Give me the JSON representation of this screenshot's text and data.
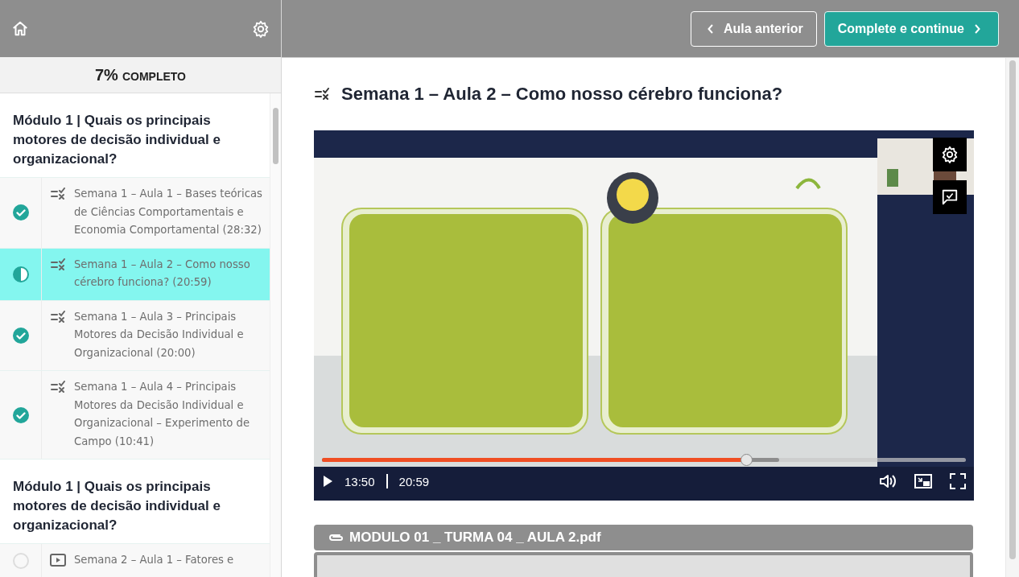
{
  "topbar": {
    "buttons": [
      {
        "label": "Aula anterior",
        "kind": "prev"
      },
      {
        "label": "Complete e continue",
        "kind": "next"
      }
    ]
  },
  "sidebar": {
    "progress": {
      "percent": "7%",
      "label": "COMPLETO"
    },
    "sections": [
      {
        "title": "Módulo 1 | Quais os principais motores de decisão individual e organizacional?",
        "lessons": [
          {
            "title": "Semana 1 – Aula 1 – Bases teóricas de Ciências Comportamentais e Economia Comportamental (28:32)",
            "kind": "quiz",
            "completed": true,
            "selected": false
          },
          {
            "title": "Semana 1 – Aula 2 – Como nosso cérebro funciona? (20:59)",
            "kind": "quiz",
            "completed": false,
            "selected": true
          },
          {
            "title": "Semana 1 – Aula 3 – Principais Motores da Decisão Individual e Organizacional (20:00)",
            "kind": "quiz",
            "completed": true,
            "selected": false
          },
          {
            "title": "Semana 1 – Aula 4 – Principais Motores da Decisão Individual e Organizacional – Experimento de Campo (10:41)",
            "kind": "quiz",
            "completed": true,
            "selected": false
          }
        ]
      },
      {
        "title": "Módulo 1 | Quais os principais motores de decisão individual e organizacional?",
        "lessons": [
          {
            "title": "Semana 2 – Aula 1 – Fatores e",
            "kind": "video",
            "completed": false,
            "selected": false
          }
        ]
      }
    ]
  },
  "lesson": {
    "title": "Semana 1 – Aula 2 – Como nosso cérebro funciona?",
    "kind": "quiz"
  },
  "player": {
    "kind": "picture",
    "current_time": "13:50",
    "duration": "20:59",
    "level": 0.66
  },
  "attachment": {
    "name": "MODULO 01 _ TURMA 04 _ AULA 2.pdf"
  }
}
